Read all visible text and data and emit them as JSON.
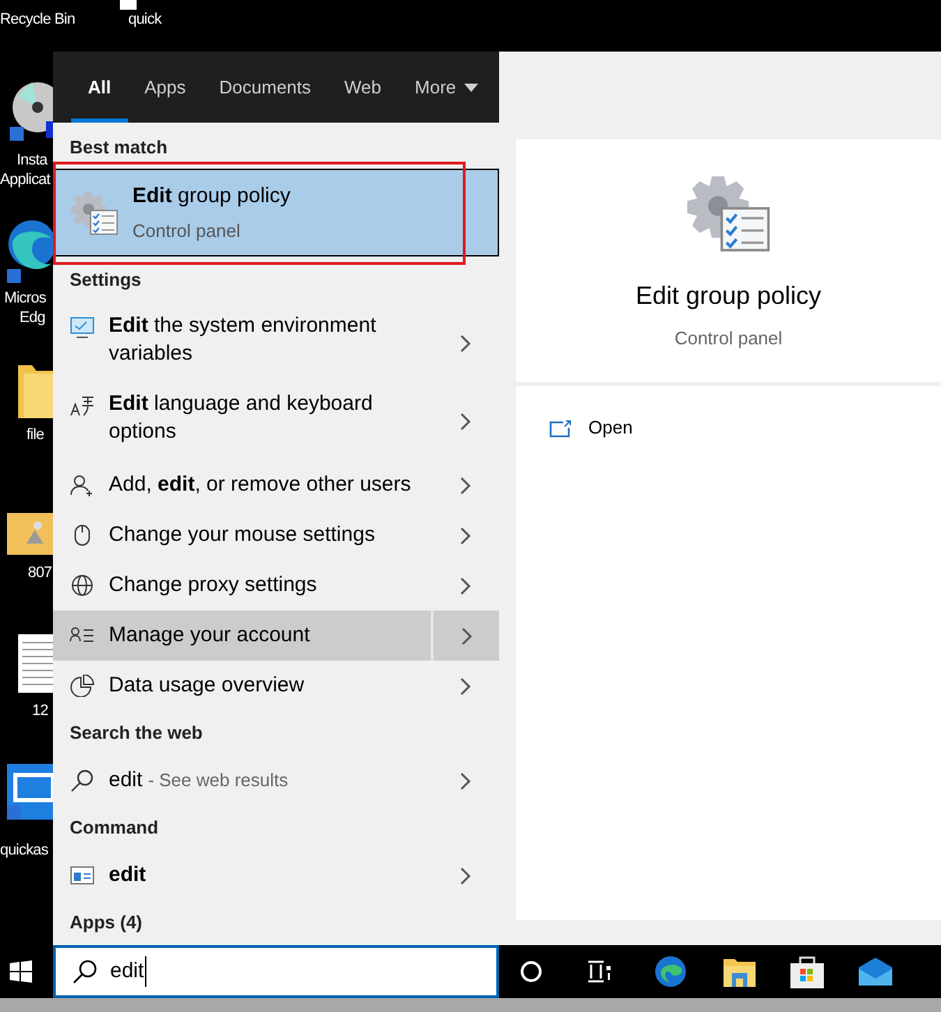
{
  "desktop_icons": [
    {
      "label": "Recycle Bin"
    },
    {
      "label": "quick"
    },
    {
      "label": "Insta"
    },
    {
      "label": "Applicat"
    },
    {
      "label": "Micros"
    },
    {
      "label": "Edg"
    },
    {
      "label": "file"
    },
    {
      "label": "807"
    },
    {
      "label": "12"
    },
    {
      "label": "quickas"
    }
  ],
  "tabs": [
    {
      "label": "All",
      "selected": true,
      "dropdown": false
    },
    {
      "label": "Apps",
      "selected": false,
      "dropdown": false
    },
    {
      "label": "Documents",
      "selected": false,
      "dropdown": false
    },
    {
      "label": "Web",
      "selected": false,
      "dropdown": false
    },
    {
      "label": "More",
      "selected": false,
      "dropdown": true
    }
  ],
  "best_match": {
    "heading": "Best match",
    "title": "**Edit** group policy",
    "subtitle": "Control panel",
    "selected": true
  },
  "sections": [
    {
      "heading": "Settings",
      "items": [
        {
          "kind": "setting",
          "text": "**Edit** the system environment variables",
          "selected": false
        },
        {
          "kind": "setting",
          "text": "**Edit** language and keyboard options",
          "selected": false
        },
        {
          "kind": "setting",
          "text": "Add, **edit**, or remove other users",
          "selected": false
        },
        {
          "kind": "setting",
          "text": "Change your mouse settings",
          "selected": false
        },
        {
          "kind": "setting",
          "text": "Change proxy settings",
          "selected": false
        },
        {
          "kind": "setting",
          "text": "Manage your account",
          "selected": true
        },
        {
          "kind": "setting",
          "text": "Data usage overview",
          "selected": false
        }
      ]
    },
    {
      "heading": "Search the web",
      "items": [
        {
          "kind": "web",
          "text": "edit",
          "hint": "- See web results",
          "selected": false
        }
      ]
    },
    {
      "heading": "Command",
      "items": [
        {
          "kind": "command",
          "text": "edit",
          "selected": false
        }
      ]
    }
  ],
  "apps_heading": "Apps (4)",
  "preview": {
    "title": "Edit group policy",
    "subtitle": "Control panel",
    "actions": [
      {
        "label": "Open"
      }
    ]
  },
  "search": {
    "value": "edit"
  }
}
